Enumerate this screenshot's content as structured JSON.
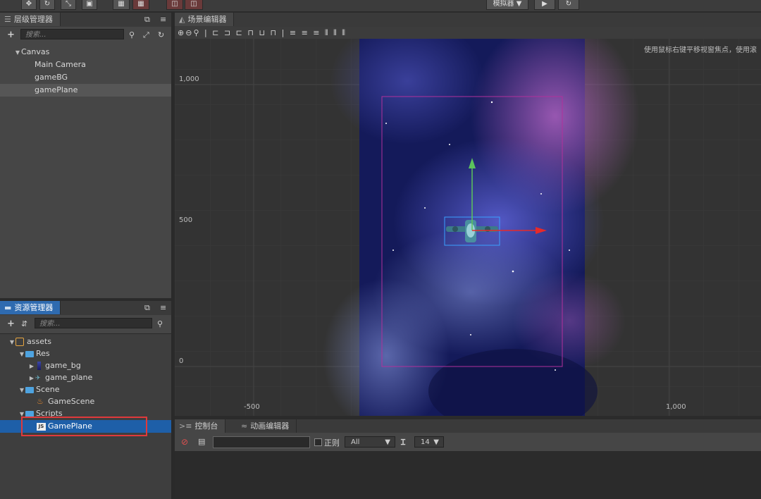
{
  "toolbar": {
    "simulator_label": "模拟器 ▼",
    "play_icon": "play-icon",
    "refresh_icon": "refresh-icon"
  },
  "hierarchy": {
    "tab_title": "层级管理器",
    "search_placeholder": "搜索...",
    "nodes": [
      {
        "label": "Canvas",
        "depth": 0,
        "expanded": true
      },
      {
        "label": "Main Camera",
        "depth": 1
      },
      {
        "label": "gameBG",
        "depth": 1
      },
      {
        "label": "gamePlane",
        "depth": 1,
        "selected": true
      }
    ]
  },
  "assets": {
    "tab_title": "资源管理器",
    "search_placeholder": "搜索...",
    "items": [
      {
        "label": "assets",
        "depth": 0,
        "type": "root"
      },
      {
        "label": "Res",
        "depth": 1,
        "type": "folder"
      },
      {
        "label": "game_bg",
        "depth": 2,
        "type": "image"
      },
      {
        "label": "game_plane",
        "depth": 2,
        "type": "image"
      },
      {
        "label": "Scene",
        "depth": 1,
        "type": "folder"
      },
      {
        "label": "GameScene",
        "depth": 2,
        "type": "scene"
      },
      {
        "label": "Scripts",
        "depth": 1,
        "type": "folder"
      },
      {
        "label": "GamePlane",
        "depth": 2,
        "type": "script",
        "selected": true
      }
    ],
    "js_badge": "JS"
  },
  "scene_editor": {
    "tab_title": "场景编辑器",
    "hint": "使用鼠标右键平移视窗焦点，使用滚",
    "y_labels": [
      "1,000",
      "500",
      "0"
    ],
    "x_labels": [
      "-500",
      "1,000"
    ]
  },
  "console": {
    "tab_title": "控制台",
    "anim_tab_title": "动画编辑器",
    "regex_label": "正则",
    "filter_value": "All",
    "font_size_value": "14"
  },
  "colors": {
    "accent_blue": "#2f6bb0",
    "selection_red": "#e0393b",
    "canvas_border": "#b1309c",
    "gizmo_green": "#5cc45c",
    "gizmo_red": "#e62a2a"
  }
}
